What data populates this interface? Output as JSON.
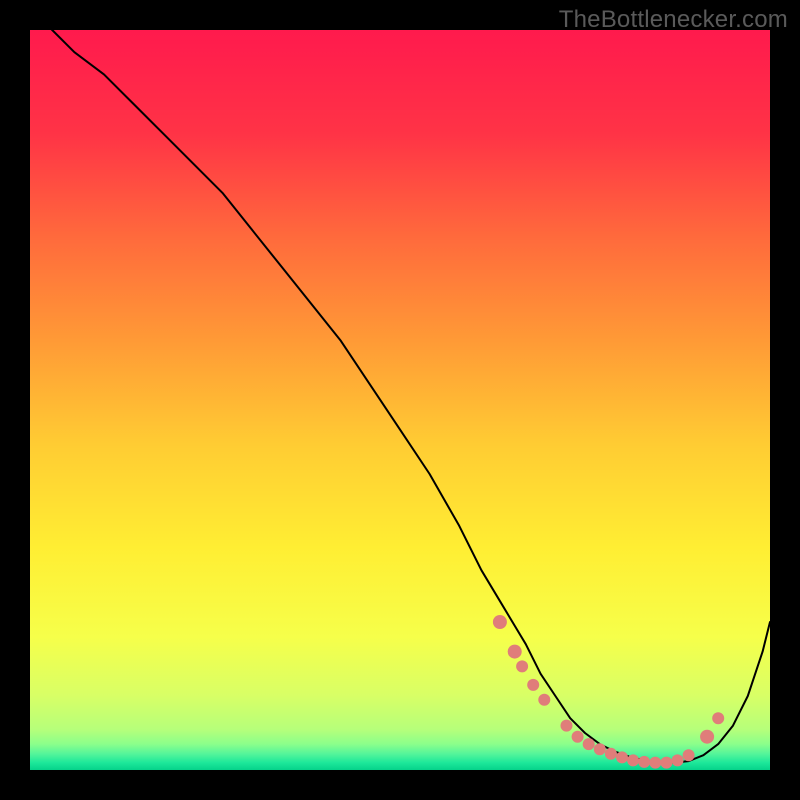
{
  "watermark": "TheBottlenecker.com",
  "chart_data": {
    "type": "line",
    "title": "",
    "xlabel": "",
    "ylabel": "",
    "xlim": [
      0,
      100
    ],
    "ylim": [
      0,
      100
    ],
    "grid": false,
    "background_gradient": {
      "stops": [
        {
          "pos": 0.0,
          "color": "#ff1a4d"
        },
        {
          "pos": 0.14,
          "color": "#ff3346"
        },
        {
          "pos": 0.28,
          "color": "#ff6a3c"
        },
        {
          "pos": 0.42,
          "color": "#ff9a36"
        },
        {
          "pos": 0.56,
          "color": "#ffcc33"
        },
        {
          "pos": 0.7,
          "color": "#ffee33"
        },
        {
          "pos": 0.82,
          "color": "#f6ff4a"
        },
        {
          "pos": 0.9,
          "color": "#d8ff66"
        },
        {
          "pos": 0.945,
          "color": "#b6ff7a"
        },
        {
          "pos": 0.965,
          "color": "#8bff8b"
        },
        {
          "pos": 0.978,
          "color": "#55f59a"
        },
        {
          "pos": 0.99,
          "color": "#1de89a"
        },
        {
          "pos": 1.0,
          "color": "#05d28a"
        }
      ]
    },
    "series": [
      {
        "name": "bottleneck-curve",
        "color": "#000000",
        "stroke_width": 2,
        "x": [
          0,
          3,
          6,
          10,
          14,
          18,
          22,
          26,
          30,
          34,
          38,
          42,
          46,
          50,
          54,
          58,
          61,
          64,
          67,
          69,
          71,
          73,
          75,
          77,
          79,
          81,
          83,
          85,
          87,
          89,
          91,
          93,
          95,
          97,
          99,
          100
        ],
        "y": [
          103,
          100,
          97,
          94,
          90,
          86,
          82,
          78,
          73,
          68,
          63,
          58,
          52,
          46,
          40,
          33,
          27,
          22,
          17,
          13,
          10,
          7,
          5,
          3.5,
          2.5,
          1.8,
          1.3,
          1.0,
          1.0,
          1.2,
          2.0,
          3.5,
          6.0,
          10,
          16,
          20
        ]
      }
    ],
    "markers": {
      "name": "highlight-dots",
      "color": "#e07d7a",
      "radius": 6,
      "points": [
        {
          "x": 63.5,
          "y": 20.0,
          "r": 7
        },
        {
          "x": 65.5,
          "y": 16.0,
          "r": 7
        },
        {
          "x": 66.5,
          "y": 14.0,
          "r": 6
        },
        {
          "x": 68.0,
          "y": 11.5,
          "r": 6
        },
        {
          "x": 69.5,
          "y": 9.5,
          "r": 6
        },
        {
          "x": 72.5,
          "y": 6.0,
          "r": 6
        },
        {
          "x": 74.0,
          "y": 4.5,
          "r": 6
        },
        {
          "x": 75.5,
          "y": 3.5,
          "r": 6
        },
        {
          "x": 77.0,
          "y": 2.8,
          "r": 6
        },
        {
          "x": 78.5,
          "y": 2.2,
          "r": 6
        },
        {
          "x": 80.0,
          "y": 1.7,
          "r": 6
        },
        {
          "x": 81.5,
          "y": 1.3,
          "r": 6
        },
        {
          "x": 83.0,
          "y": 1.1,
          "r": 6
        },
        {
          "x": 84.5,
          "y": 1.0,
          "r": 6
        },
        {
          "x": 86.0,
          "y": 1.0,
          "r": 6
        },
        {
          "x": 87.5,
          "y": 1.3,
          "r": 6
        },
        {
          "x": 89.0,
          "y": 2.0,
          "r": 6
        },
        {
          "x": 91.5,
          "y": 4.5,
          "r": 7
        },
        {
          "x": 93.0,
          "y": 7.0,
          "r": 6
        }
      ]
    }
  }
}
